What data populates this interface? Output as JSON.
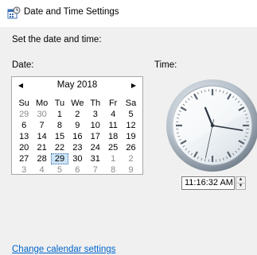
{
  "window": {
    "title": "Date and Time Settings",
    "title_icon": "date-time-settings-icon"
  },
  "dialog": {
    "heading": "Set the date and time:",
    "date_label": "Date:",
    "time_label": "Time:",
    "change_calendar_link": "Change calendar settings"
  },
  "calendar": {
    "month_year": "May 2018",
    "prev_icon": "◀",
    "next_icon": "▶",
    "weekdays": [
      "Su",
      "Mo",
      "Tu",
      "We",
      "Th",
      "Fr",
      "Sa"
    ],
    "weeks": [
      [
        {
          "d": "29",
          "other": true
        },
        {
          "d": "30",
          "other": true
        },
        {
          "d": "1"
        },
        {
          "d": "2"
        },
        {
          "d": "3"
        },
        {
          "d": "4"
        },
        {
          "d": "5"
        }
      ],
      [
        {
          "d": "6"
        },
        {
          "d": "7"
        },
        {
          "d": "8"
        },
        {
          "d": "9"
        },
        {
          "d": "10"
        },
        {
          "d": "11"
        },
        {
          "d": "12"
        }
      ],
      [
        {
          "d": "13"
        },
        {
          "d": "14"
        },
        {
          "d": "15"
        },
        {
          "d": "16"
        },
        {
          "d": "17"
        },
        {
          "d": "18"
        },
        {
          "d": "19"
        }
      ],
      [
        {
          "d": "20"
        },
        {
          "d": "21"
        },
        {
          "d": "22"
        },
        {
          "d": "23"
        },
        {
          "d": "24"
        },
        {
          "d": "25"
        },
        {
          "d": "26"
        }
      ],
      [
        {
          "d": "27"
        },
        {
          "d": "28"
        },
        {
          "d": "29",
          "selected": true
        },
        {
          "d": "30"
        },
        {
          "d": "31"
        },
        {
          "d": "1",
          "other": true
        },
        {
          "d": "2",
          "other": true
        }
      ],
      [
        {
          "d": "3",
          "other": true
        },
        {
          "d": "4",
          "other": true
        },
        {
          "d": "5",
          "other": true
        },
        {
          "d": "6",
          "other": true
        },
        {
          "d": "7",
          "other": true
        },
        {
          "d": "8",
          "other": true
        },
        {
          "d": "9",
          "other": true
        }
      ]
    ],
    "selected_day": "29"
  },
  "clock": {
    "hours": 11,
    "minutes": 16,
    "seconds": 32
  },
  "time_input": {
    "value": "11:16:32 AM",
    "spin_up": "▲",
    "spin_down": "▼"
  },
  "colors": {
    "link": "#0066cc",
    "panel_bg": "#f0f0f0",
    "selected_day_bg": "#cce4f7"
  }
}
